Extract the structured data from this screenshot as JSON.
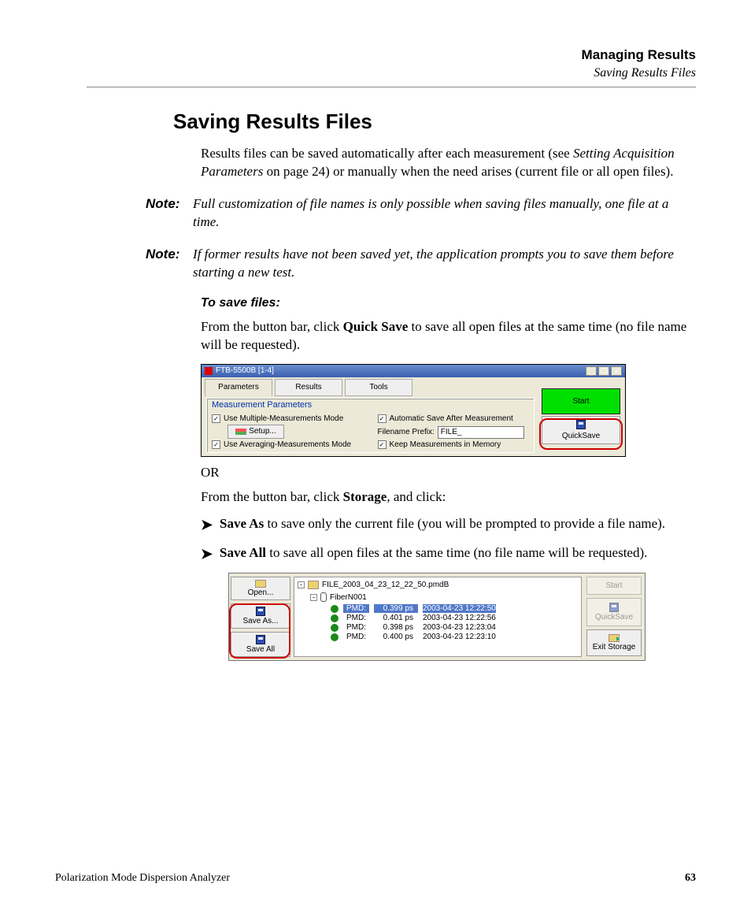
{
  "header": {
    "chapter": "Managing Results",
    "section": "Saving Results Files"
  },
  "title": "Saving Results Files",
  "intro": {
    "text_a": "Results files can be saved automatically after each measurement (see ",
    "ref": "Setting Acquisition Parameters",
    "text_b": " on page 24) or manually when the need arises (current file or all open files)."
  },
  "notes": [
    {
      "label": "Note:",
      "text": "Full customization of file names is only possible when saving files manually, one file at a time."
    },
    {
      "label": "Note:",
      "text": "If former results have not been saved yet, the application prompts you to save them before starting a new test."
    }
  ],
  "subheading": "To save files:",
  "instr1": {
    "pre": "From the button bar, click ",
    "bold": "Quick Save",
    "post": " to save all open files at the same time (no file name will be requested)."
  },
  "or": "OR",
  "instr2": {
    "pre": "From the button bar, click ",
    "bold": "Storage",
    "post": ", and click:"
  },
  "bullets": [
    {
      "bold": "Save As",
      "rest": " to save only the current file (you will be prompted to provide a file name)."
    },
    {
      "bold": "Save All",
      "rest": " to save all open files at the same time (no file name will be requested)."
    }
  ],
  "shot1": {
    "window_title": "FTB-5500B [1-4]",
    "tabs": [
      "Parameters",
      "Results",
      "Tools"
    ],
    "group_title": "Measurement Parameters",
    "chk_multi": "Use Multiple-Measurements Mode",
    "setup_btn": "Setup...",
    "chk_avg": "Use Averaging-Measurements Mode",
    "chk_autosave": "Automatic Save After Measurement",
    "prefix_label": "Filename Prefix:",
    "prefix_value": "FILE_",
    "chk_memory": "Keep Measurements in Memory",
    "start_btn": "Start",
    "quicksave_btn": "QuickSave"
  },
  "shot2": {
    "left": {
      "open": "Open...",
      "save_as": "Save As...",
      "save_all": "Save All"
    },
    "root_label": "FILE_2003_04_23_12_22_50.pmdB",
    "fiber_label": "FiberN001",
    "rows": [
      {
        "tag": "PMD:",
        "val": "0.399 ps",
        "ts": "2003-04-23 12:22:50",
        "sel": true
      },
      {
        "tag": "PMD:",
        "val": "0.401 ps",
        "ts": "2003-04-23 12:22:56",
        "sel": false
      },
      {
        "tag": "PMD:",
        "val": "0.398 ps",
        "ts": "2003-04-23 12:23:04",
        "sel": false
      },
      {
        "tag": "PMD:",
        "val": "0.400 ps",
        "ts": "2003-04-23 12:23:10",
        "sel": false
      }
    ],
    "right": {
      "start": "Start",
      "quicksave": "QuickSave",
      "exit": "Exit Storage"
    }
  },
  "footer": {
    "doc": "Polarization Mode Dispersion Analyzer",
    "page": "63"
  }
}
